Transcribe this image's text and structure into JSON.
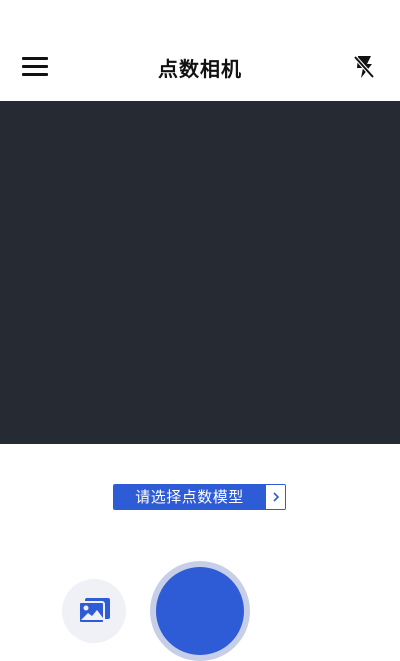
{
  "header": {
    "title": "点数相机",
    "menu_icon": "hamburger-menu-icon",
    "flash_icon": "flash-off-icon"
  },
  "preview": {
    "background": "#252a33"
  },
  "model_selector": {
    "label": "请选择点数模型",
    "chevron": "›"
  },
  "controls": {
    "gallery_icon": "image-gallery-icon",
    "shutter_icon": "shutter-button"
  },
  "colors": {
    "accent": "#2e5bd6",
    "shutter_ring": "#c7cfe8",
    "gallery_bg": "#eff1f6"
  }
}
